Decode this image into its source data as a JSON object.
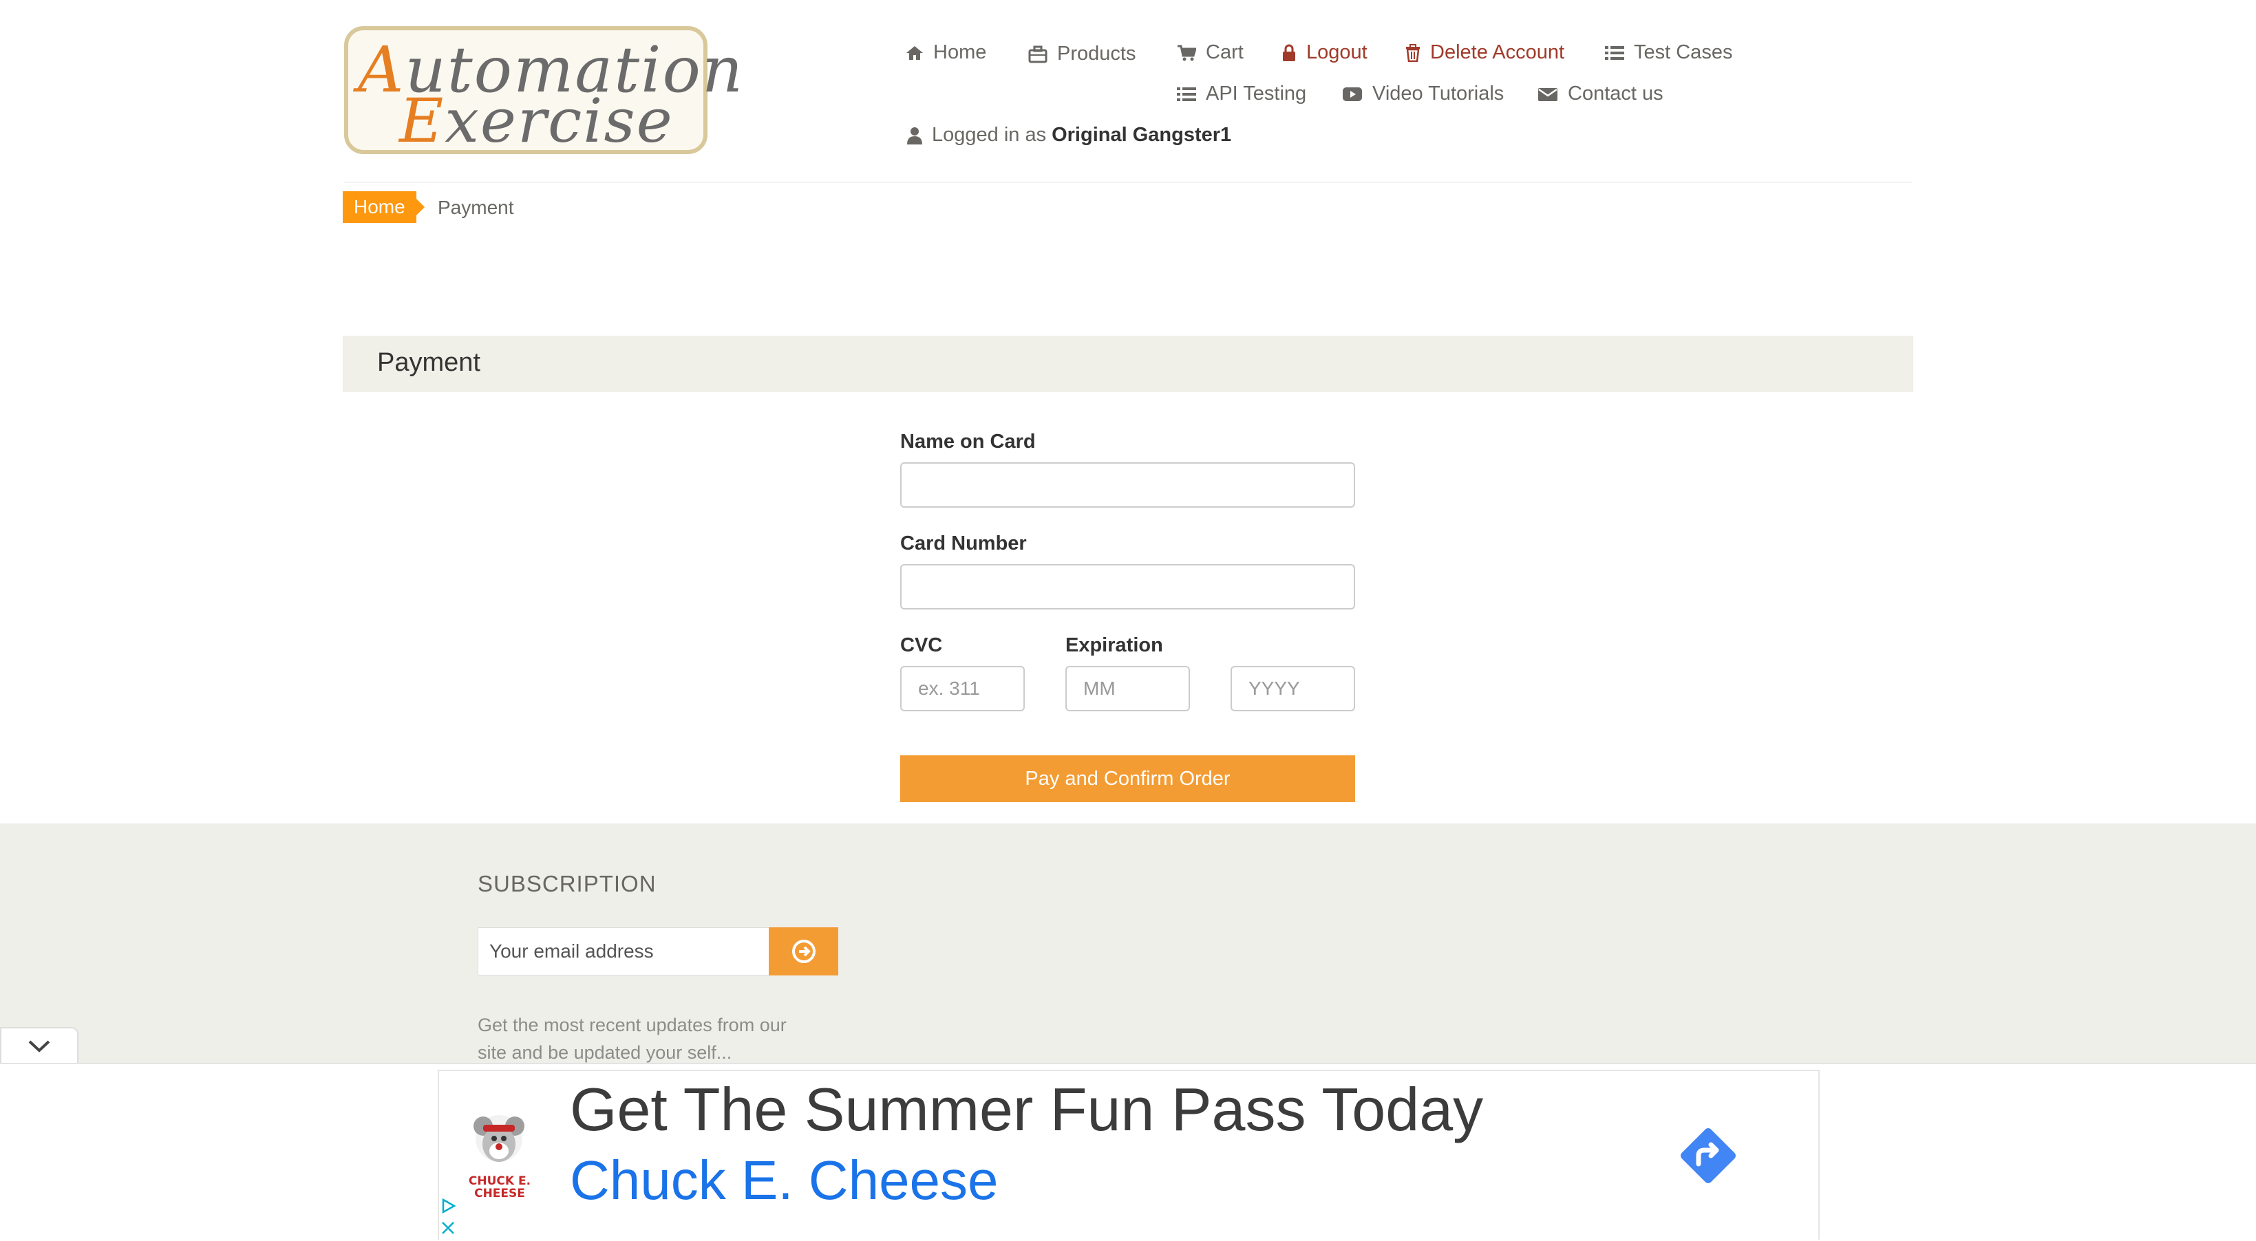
{
  "logo": {
    "line1_cap": "A",
    "line1_rest": "utomation",
    "line2_cap": "E",
    "line2_rest": "xercise"
  },
  "nav": {
    "home": "Home",
    "products": "Products",
    "cart": "Cart",
    "logout": "Logout",
    "delete_account": "Delete Account",
    "test_cases": "Test Cases",
    "api_testing": "API Testing",
    "video_tutorials": "Video Tutorials",
    "contact_us": "Contact us",
    "logged_in_prefix": "Logged in as",
    "username": "Original Gangster1"
  },
  "breadcrumb": {
    "home": "Home",
    "current": "Payment"
  },
  "payment": {
    "heading": "Payment",
    "name_label": "Name on Card",
    "name_value": "",
    "card_label": "Card Number",
    "card_value": "",
    "cvc_label": "CVC",
    "cvc_placeholder": "ex. 311",
    "expiration_label": "Expiration",
    "month_placeholder": "MM",
    "year_placeholder": "YYYY",
    "submit_label": "Pay and Confirm Order"
  },
  "subscription": {
    "title": "SUBSCRIPTION",
    "email_placeholder": "Your email address",
    "description": "Get the most recent updates from our site and be updated your self..."
  },
  "ad": {
    "headline": "Get The Summer Fun Pass Today",
    "brand": "Chuck E. Cheese",
    "logo_text": "CHUCK E. CHEESE"
  },
  "colors": {
    "accent": "#fe980f",
    "button": "#f39c34",
    "danger": "#a03a2a",
    "ad_link": "#1a73e8"
  }
}
